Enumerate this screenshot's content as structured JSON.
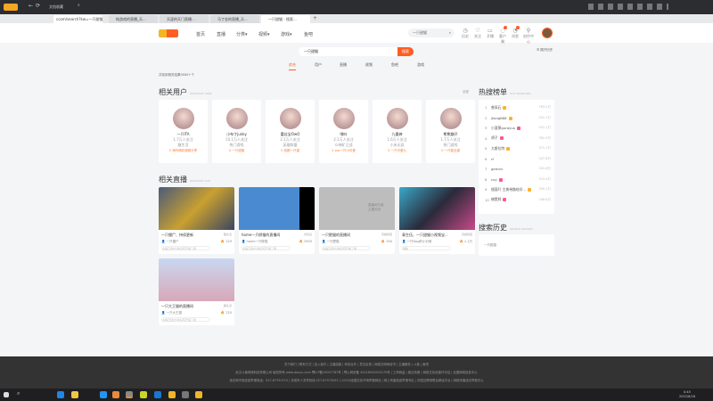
{
  "browser": {
    "address": "ccom/search?kw=一只甜猫",
    "toolbar_label": "文档收藏",
    "tabs": [
      "纯游戏的直播_天...",
      "天涯的天门直播...",
      "马丁金的直播_天...",
      "一只甜猫 - 搜索..."
    ],
    "new_tab": "+"
  },
  "header": {
    "nav": [
      "首页",
      "直播",
      "分类▾",
      "视频▾",
      "游戏▾",
      "鱼吧"
    ],
    "search_value": "一只甜猫",
    "icons": [
      {
        "icon": "history-icon",
        "label": "历史"
      },
      {
        "icon": "follow-icon",
        "label": "关注"
      },
      {
        "icon": "video-icon",
        "label": "开播"
      },
      {
        "icon": "message-icon",
        "label": "客户端"
      },
      {
        "icon": "notice-icon",
        "label": "消息"
      },
      {
        "icon": "location-icon",
        "label": "创作中心"
      }
    ]
  },
  "search": {
    "value": "一只甜猫",
    "button": "搜索",
    "history_toggle": "☰ 展开历史",
    "tabs": [
      "综合",
      "用户",
      "直播",
      "视频",
      "鱼吧",
      "游戏"
    ],
    "active_tab": 0,
    "result_count": "共找到相关结果9000+个"
  },
  "users_section": {
    "title": "相关用户",
    "subtitle": "RELEVANT USER",
    "more": "全部",
    "users": [
      {
        "name": "一只ITA",
        "fans": "1.7万人关注",
        "cat": "趣生活",
        "room": "V 海外精彩视频分享"
      },
      {
        "name": "小布丁junky",
        "fans": "10.1万人关注",
        "cat": "热门游戏",
        "room": "V 一只甜猫"
      },
      {
        "name": "蕾丝宝OwO",
        "fans": "2.1万人关注",
        "cat": "英雄联盟",
        "room": "V 成都一只猫"
      },
      {
        "name": "嘿咔",
        "fans": "2.1万人关注",
        "cat": "众神矿之战",
        "room": "V zzo一只小可爱"
      },
      {
        "name": "九墨婷",
        "fans": "1.6万人关注",
        "cat": "小米无双",
        "room": "V 一只可爱九"
      },
      {
        "name": "熊熊趣仔",
        "fans": "1.7万人关注",
        "cat": "热门游戏",
        "room": "V 一只能出猫"
      }
    ]
  },
  "live_section": {
    "title": "相关直播",
    "subtitle": "RELEVANT LIVE",
    "lives": [
      {
        "title": "一只僵尸、持续更新",
        "cat": "趣生活",
        "host": "一只僵尸",
        "hot": "229",
        "tag": "主播已经8分钟没有开播了哦"
      },
      {
        "title": "home一只胖猫的直播间",
        "cat": "冒险岛",
        "host": "home一只胖猫",
        "hot": "2900",
        "tag": "主播已经8分钟没有开播了哦"
      },
      {
        "title": "一只肥猫的直播间",
        "cat": "英雄联盟",
        "host": "一只肥猫",
        "hot": "294",
        "tag": "主播已经8分钟没有开播了哦"
      },
      {
        "title": "青生伍、一只甜猫小视频宝...",
        "cat": "英雄联盟",
        "host": "一只Dog的小分家",
        "hot": "1.1万",
        "tag": "辅助"
      },
      {
        "title": "一只大王猫的直播间",
        "cat": "趣生活",
        "host": "一只大王猫",
        "hot": "220",
        "tag": "主播已经8分钟没有开播了哦"
      }
    ],
    "offline_text": "直播间已被 主播关闭"
  },
  "hot_list": {
    "title": "热搜榜单",
    "subtitle": "HOT SEARCHED",
    "items": [
      {
        "rank": "1",
        "name": "曾采石",
        "value": "783.2万"
      },
      {
        "rank": "2",
        "name": "jkong888",
        "value": "431.1万"
      },
      {
        "rank": "3",
        "name": "小菠萝gurayuu",
        "value": "431.1万"
      },
      {
        "rank": "4",
        "name": "胡子",
        "value": "392.0万"
      },
      {
        "rank": "5",
        "name": "大斯拉特",
        "value": "371.1万"
      },
      {
        "rank": "6",
        "name": "rf",
        "value": "347.8万"
      },
      {
        "rank": "7",
        "name": "gemini",
        "value": "341.6万"
      },
      {
        "rank": "8",
        "name": "cxy",
        "value": "313.4万"
      },
      {
        "rank": "9",
        "name": "镜面吖 主美带路给好...",
        "value": "300.1万"
      },
      {
        "rank": "10",
        "name": "楠赞胖",
        "value": "296.6万"
      }
    ]
  },
  "history": {
    "title": "搜索历史",
    "subtitle": "SEARCH HISTORY",
    "items": [
      "一只甜猫"
    ]
  },
  "footer": {
    "line1": "关于我们 | 联系方式 | 加入我们 | 主播招募 | 商务合作 | 意见反馈 | 网络文明承诺书 | 主播服务 | 斗鱼 | 鱼吧",
    "line2": "武汉斗鱼网络科技有限公司 版权所有 www.douyu.com 鄂ICP备15007787号 | 鄂公网安备 42018502000170号 | 工商网监 | 营业执照 | 网络文化经营许可证 | 全国网络信息中心",
    "line3": "违法和不良信息举报电话：027-87750710 | 未成年人关怀热线 027-87573053 | 12318全国文化市场举报网站 | 网上有害信息举报专区 | 中国互联网联合辟谣平台 | 网络传播违法举报中心"
  },
  "taskbar": {
    "time": "0:45",
    "date": "2022/8/18"
  }
}
